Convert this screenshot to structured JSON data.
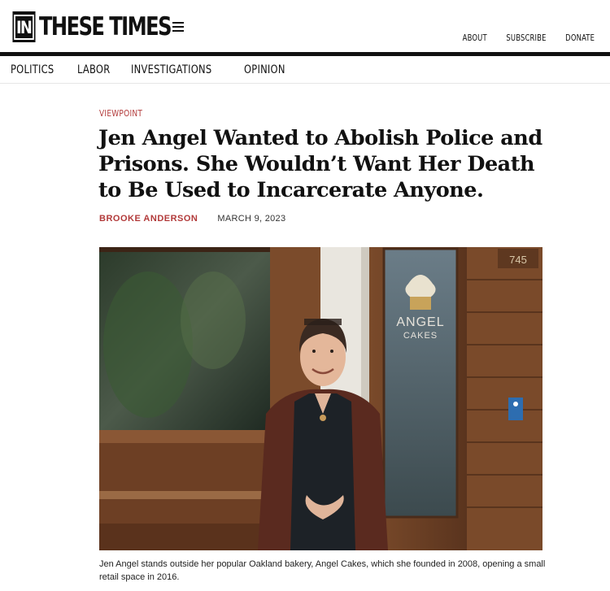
{
  "header": {
    "logo_box": "IN",
    "logo_text": "THESE TIMES",
    "links": [
      "ABOUT",
      "SUBSCRIBE",
      "DONATE"
    ]
  },
  "nav": [
    "POLITICS",
    "LABOR",
    "INVESTIGATIONS",
    "OPINION"
  ],
  "article": {
    "kicker": "VIEWPOINT",
    "headline": "Jen Angel Wanted to Abolish Police and Prisons. She Wouldn’t Want Her Death to Be Used to Incarcerate Anyone.",
    "author": "BROOKE ANDERSON",
    "date": "MARCH 9, 2023"
  },
  "photo": {
    "sign_line1": "ANGEL",
    "sign_line2": "CAKES",
    "house_number": "745"
  },
  "caption": "Jen Angel stands outside her popular Oakland bakery, Angel Cakes, which she founded in 2008, opening a small retail space in 2016."
}
